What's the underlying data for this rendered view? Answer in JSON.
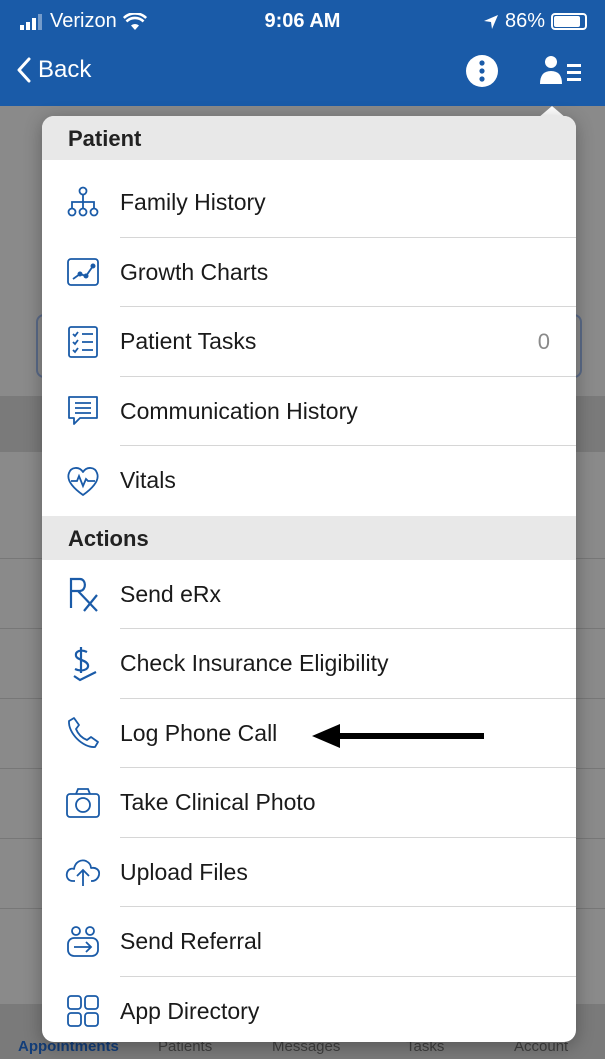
{
  "status_bar": {
    "carrier": "Verizon",
    "time": "9:06 AM",
    "battery": "86%"
  },
  "nav": {
    "back_label": "Back"
  },
  "menu": {
    "patient_header": "Patient",
    "patient_items": [
      {
        "label": "Family History",
        "icon": "family-tree-icon"
      },
      {
        "label": "Growth Charts",
        "icon": "growth-chart-icon"
      },
      {
        "label": "Patient Tasks",
        "icon": "checklist-icon",
        "count": "0"
      },
      {
        "label": "Communication History",
        "icon": "chat-bubble-icon"
      },
      {
        "label": "Vitals",
        "icon": "heart-pulse-icon"
      }
    ],
    "actions_header": "Actions",
    "action_items": [
      {
        "label": "Send eRx",
        "icon": "rx-icon"
      },
      {
        "label": "Check Insurance Eligibility",
        "icon": "dollar-icon"
      },
      {
        "label": "Log Phone Call",
        "icon": "phone-icon"
      },
      {
        "label": "Take Clinical Photo",
        "icon": "camera-icon"
      },
      {
        "label": "Upload Files",
        "icon": "cloud-upload-icon"
      },
      {
        "label": "Send Referral",
        "icon": "referral-icon"
      },
      {
        "label": "App Directory",
        "icon": "grid-icon"
      }
    ]
  },
  "tabbar": {
    "tabs": [
      "Appointments",
      "Patients",
      "Messages",
      "Tasks",
      "Account"
    ]
  },
  "colors": {
    "brand": "#1a5ba8",
    "header_bg": "#e8e8e8"
  }
}
